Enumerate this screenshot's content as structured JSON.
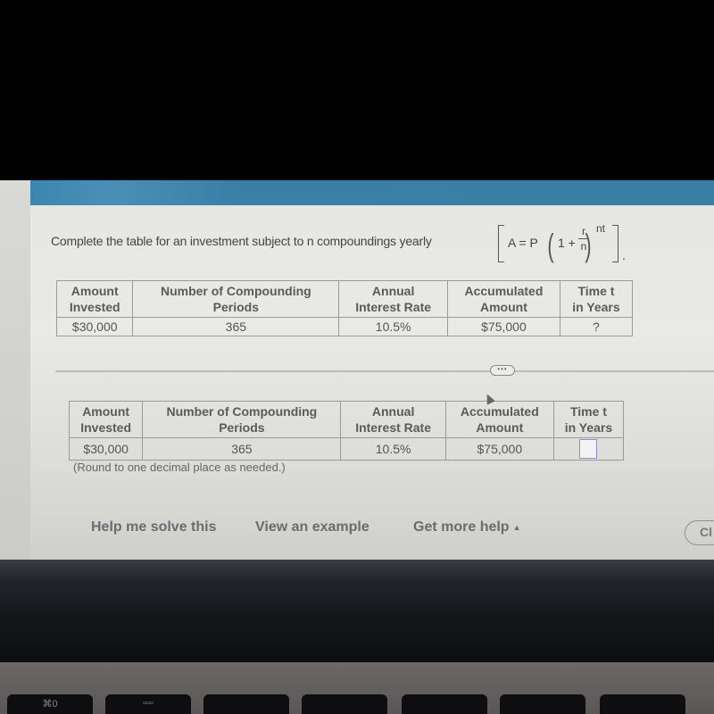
{
  "header": {
    "accent_color": "#3a7ea3"
  },
  "question": {
    "text": "Complete the table for an investment subject to n compoundings yearly",
    "formula": {
      "lhs": "A = P",
      "one_plus": "1 +",
      "numerator": "r",
      "denominator": "n",
      "exponent": "nt",
      "trailing": "."
    }
  },
  "table_given": {
    "headers": [
      [
        "Amount",
        "Invested"
      ],
      [
        "Number of Compounding",
        "Periods"
      ],
      [
        "Annual",
        "Interest Rate"
      ],
      [
        "Accumulated",
        "Amount"
      ],
      [
        "Time t",
        "in Years"
      ]
    ],
    "row": [
      "$30,000",
      "365",
      "10.5%",
      "$75,000",
      "?"
    ]
  },
  "divider": {
    "expand_label": "•••"
  },
  "table_answer": {
    "headers": [
      [
        "Amount",
        "Invested"
      ],
      [
        "Number of Compounding",
        "Periods"
      ],
      [
        "Annual",
        "Interest Rate"
      ],
      [
        "Accumulated",
        "Amount"
      ],
      [
        "Time t",
        "in Years"
      ]
    ],
    "row": [
      "$30,000",
      "365",
      "10.5%",
      "$75,000"
    ],
    "answer_value": ""
  },
  "note": "(Round to one decimal place as needed.)",
  "help": {
    "solve": "Help me solve this",
    "example": "View an example",
    "more": "Get more help",
    "more_caret": "▲",
    "check": "Cl"
  },
  "keys": [
    "⌘0",
    "▫▫▫"
  ]
}
